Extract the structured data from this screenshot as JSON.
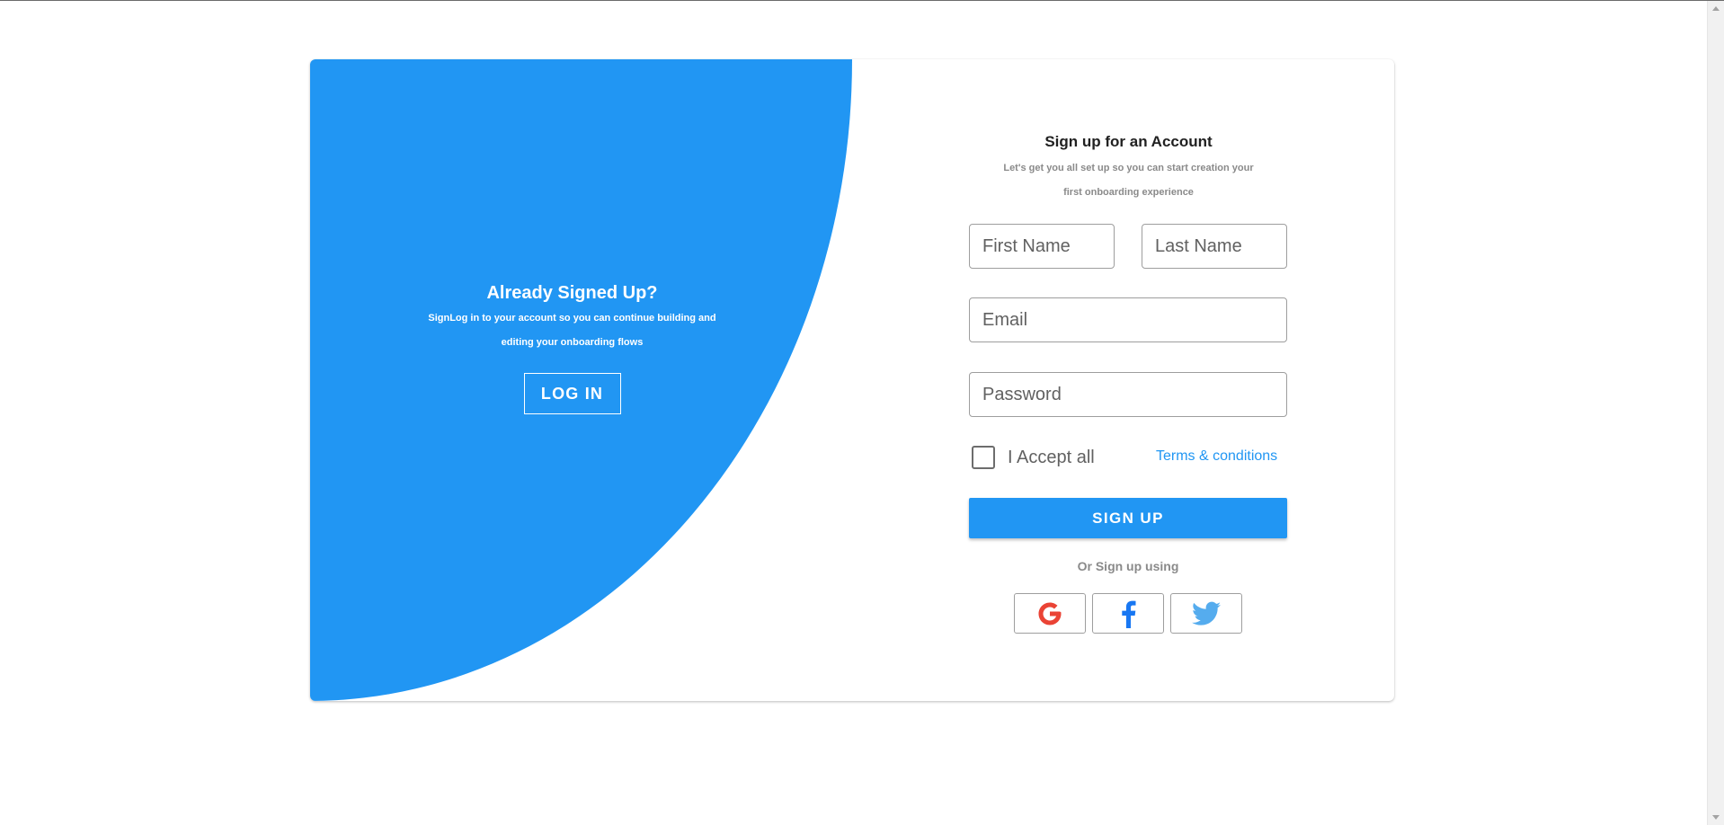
{
  "colors": {
    "primary": "#2196f3",
    "google": "#ea4335",
    "facebook": "#1877f2",
    "twitter": "#55acee"
  },
  "left": {
    "title": "Already Signed Up?",
    "desc_line1": "SignLog in to your account so you can continue building and",
    "desc_line2": "editing your onboarding flows",
    "login_label": "LOG IN"
  },
  "form": {
    "title": "Sign up for an Account",
    "sub_line1": "Let's get you all set up so you can start creation your",
    "sub_line2": "first onboarding experience",
    "first_name_placeholder": "First Name",
    "last_name_placeholder": "Last Name",
    "email_placeholder": "Email",
    "password_placeholder": "Password",
    "accept_label": "I Accept all",
    "terms_label": "Terms & conditions",
    "signup_label": "SIGN UP",
    "or_text": "Or Sign up using"
  },
  "social": [
    {
      "name": "google",
      "icon": "google-icon"
    },
    {
      "name": "facebook",
      "icon": "facebook-icon"
    },
    {
      "name": "twitter",
      "icon": "twitter-icon"
    }
  ]
}
